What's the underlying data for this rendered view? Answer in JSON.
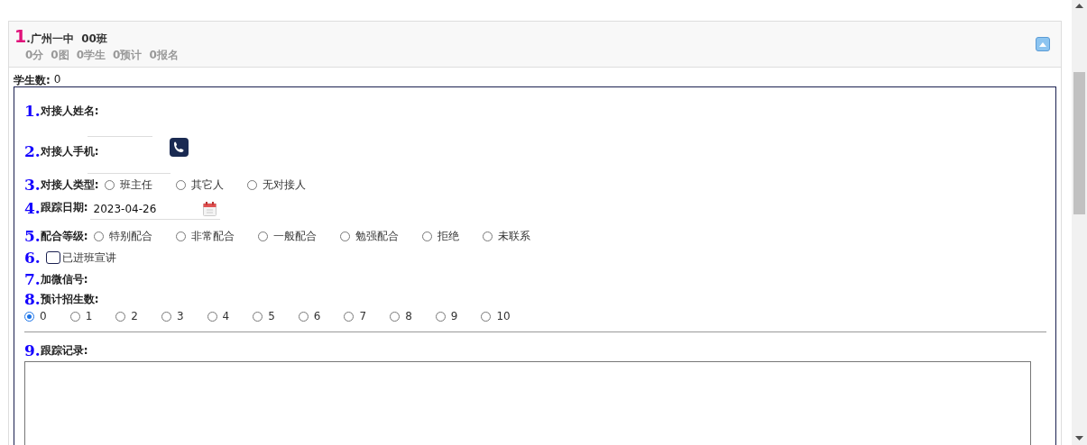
{
  "panel": {
    "index": "1",
    "title": ".广州一中  00班",
    "stats": [
      "0分",
      "0图",
      "0学生",
      "0预计",
      "0报名"
    ],
    "expanded": true
  },
  "student_count": {
    "label": "学生数:",
    "value": "0"
  },
  "form": {
    "fields": [
      {
        "kind": "text",
        "number": "1.",
        "label": "对接人姓名:"
      },
      {
        "kind": "phone",
        "number": "2.",
        "label": "对接人手机:"
      },
      {
        "kind": "radio",
        "number": "3.",
        "label": "对接人类型:",
        "options": [
          {
            "label": "班主任",
            "selected": false
          },
          {
            "label": "其它人",
            "selected": false
          },
          {
            "label": "无对接人",
            "selected": false
          }
        ]
      },
      {
        "kind": "date",
        "number": "4.",
        "label": "跟踪日期:",
        "value": "2023-04-26"
      },
      {
        "kind": "radio",
        "number": "5.",
        "label": "配合等级:",
        "options": [
          {
            "label": "特别配合",
            "selected": false
          },
          {
            "label": "非常配合",
            "selected": false
          },
          {
            "label": "一般配合",
            "selected": false
          },
          {
            "label": "勉强配合",
            "selected": false
          },
          {
            "label": "拒绝",
            "selected": false
          },
          {
            "label": "未联系",
            "selected": false
          }
        ]
      },
      {
        "kind": "checkbox",
        "number": "6.",
        "label": "已进班宣讲",
        "checked": false
      },
      {
        "kind": "label",
        "number": "7.",
        "label": "加微信号:"
      },
      {
        "kind": "radio-block",
        "number": "8.",
        "label": "预计招生数:",
        "options": [
          {
            "label": "0",
            "selected": true
          },
          {
            "label": "1",
            "selected": false
          },
          {
            "label": "2",
            "selected": false
          },
          {
            "label": "3",
            "selected": false
          },
          {
            "label": "4",
            "selected": false
          },
          {
            "label": "5",
            "selected": false
          },
          {
            "label": "6",
            "selected": false
          },
          {
            "label": "7",
            "selected": false
          },
          {
            "label": "8",
            "selected": false
          },
          {
            "label": "9",
            "selected": false
          },
          {
            "label": "10",
            "selected": false
          }
        ]
      },
      {
        "kind": "textarea",
        "number": "9.",
        "label": "跟踪记录:"
      }
    ]
  }
}
